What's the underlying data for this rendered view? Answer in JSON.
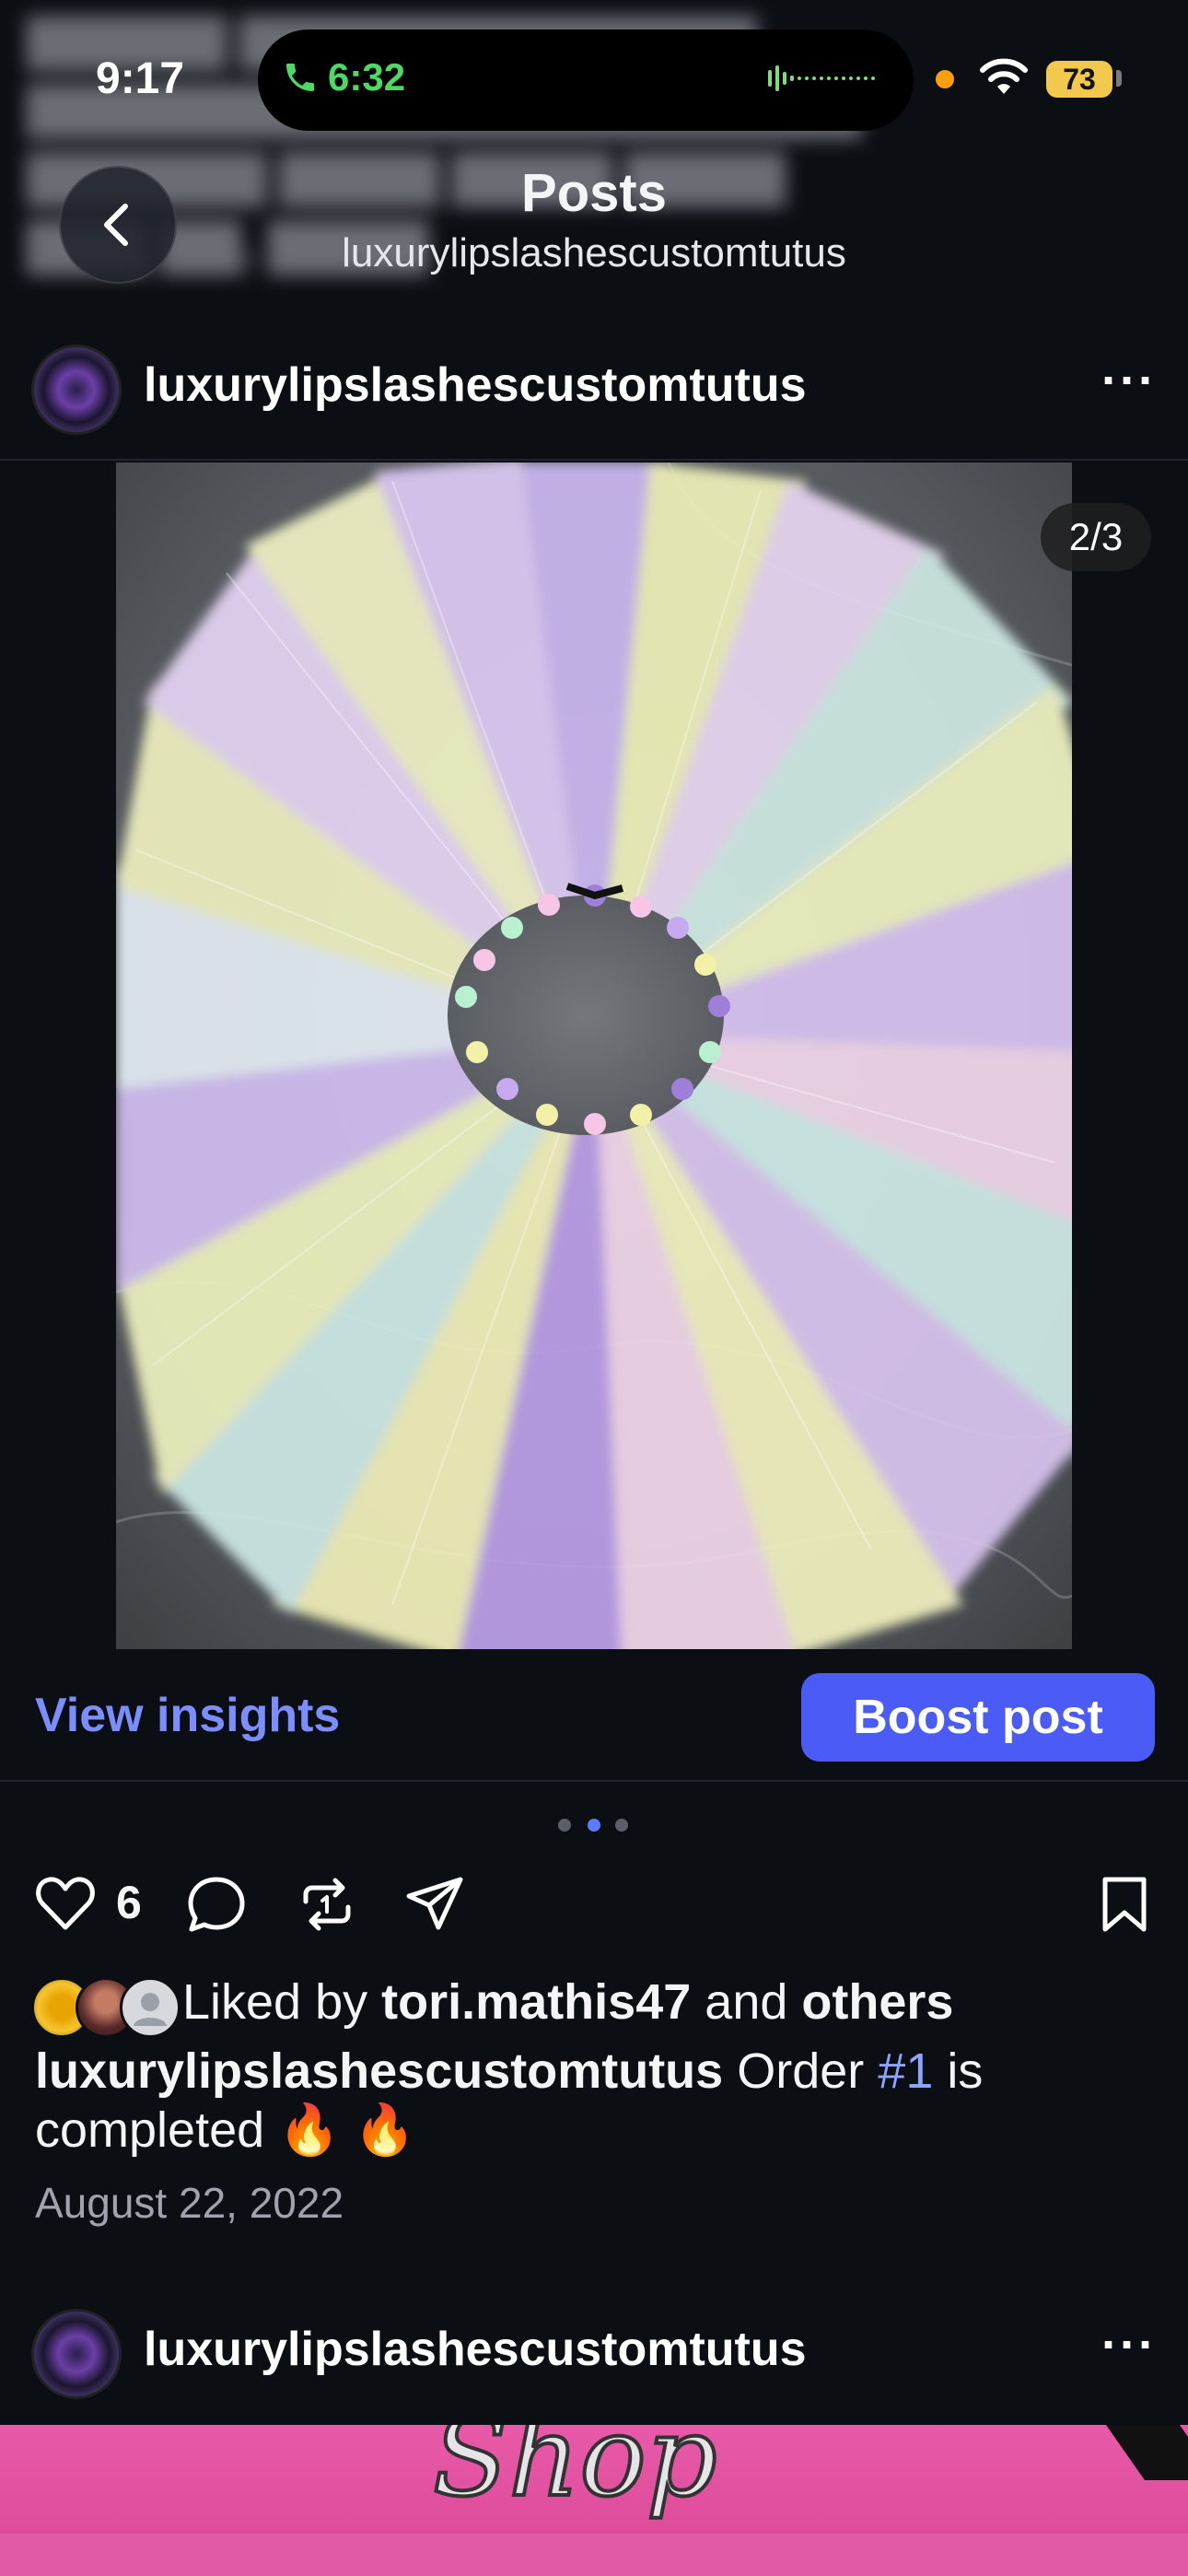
{
  "status_bar": {
    "time": "9:17",
    "call_time": "6:32",
    "battery": "73"
  },
  "header": {
    "title": "Posts",
    "subtitle": "luxurylipslashescustomtutus"
  },
  "post": {
    "username": "luxurylipslashescustomtutus",
    "image_counter": "2/3",
    "view_insights_label": "View insights",
    "boost_label": "Boost post",
    "carousel": {
      "count": 3,
      "active_index": 1
    },
    "like_count": "6",
    "liked_by_prefix": "Liked by",
    "liked_by_user": "tori.mathis47",
    "liked_by_and": "and",
    "liked_by_others": "others",
    "caption_user": "luxurylipslashescustomtutus",
    "caption_text_1": "Order",
    "caption_hashtag": "#1",
    "caption_text_2": "is completed",
    "caption_emoji": "🔥 🔥",
    "date": "August 22, 2022"
  },
  "next_post": {
    "username": "luxurylipslashescustomtutus",
    "image_text": "Shop"
  },
  "icons": {
    "back": "chevron-left-icon",
    "like": "heart-icon",
    "comment": "comment-bubble-icon",
    "repost": "repost-icon",
    "share": "paper-plane-icon",
    "save": "bookmark-icon",
    "more": "more-horizontal-icon"
  },
  "colors": {
    "background": "#0b0e13",
    "accent_link": "#7b8dff",
    "boost_button": "#4a5cf5",
    "hashtag": "#8ea2ff"
  }
}
